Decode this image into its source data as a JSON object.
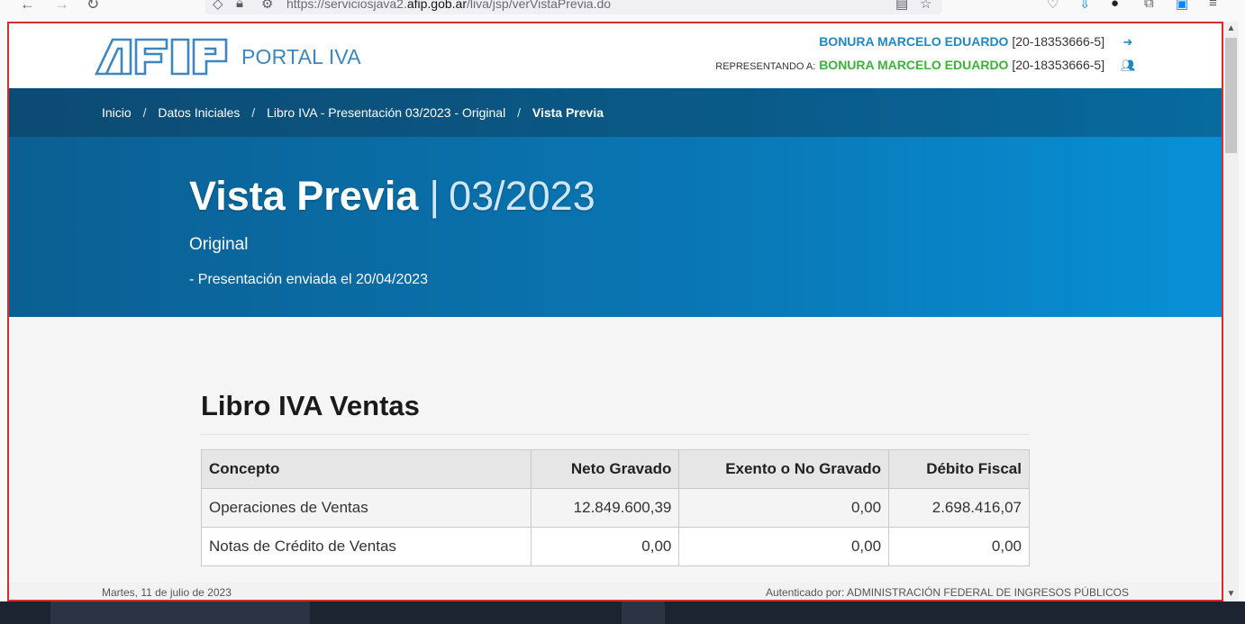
{
  "browser": {
    "url_prefix": "https://serviciosjava2.",
    "url_domain": "afip.gob.ar",
    "url_path": "/liva/jsp/verVistaPrevia.do"
  },
  "header": {
    "app_name": "PORTAL IVA",
    "user_name": "BONURA MARCELO EDUARDO",
    "user_cuit": "[20-18353666-5]",
    "representing_label": "REPRESENTANDO A:",
    "represented_name": "BONURA MARCELO EDUARDO",
    "represented_cuit": "[20-18353666-5]"
  },
  "breadcrumb": {
    "items": [
      "Inicio",
      "Datos Iniciales",
      "Libro IVA - Presentación 03/2023 - Original",
      "Vista Previa"
    ],
    "separator": "/"
  },
  "hero": {
    "title": "Vista Previa",
    "separator": "|",
    "period": "03/2023",
    "subtitle": "Original",
    "note": "- Presentación enviada el 20/04/2023"
  },
  "section": {
    "title": "Libro IVA Ventas",
    "table": {
      "headers": [
        "Concepto",
        "Neto Gravado",
        "Exento o No Gravado",
        "Débito Fiscal"
      ],
      "rows": [
        [
          "Operaciones de Ventas",
          "12.849.600,39",
          "0,00",
          "2.698.416,07"
        ],
        [
          "Notas de Crédito de Ventas",
          "0,00",
          "0,00",
          "0,00"
        ]
      ]
    }
  },
  "footer": {
    "date": "Martes, 11 de julio de 2023",
    "authenticated": "Autenticado por: ADMINISTRACIÓN FEDERAL DE INGRESOS PÚBLICOS"
  },
  "colors": {
    "brand_blue": "#3d86bf",
    "user_name_blue": "#1e88c6",
    "represented_green": "#3bb33b",
    "frame_red": "#d32f2f"
  },
  "icons": [
    "back-arrow-icon",
    "forward-arrow-icon",
    "reload-icon",
    "shield-icon",
    "lock-icon",
    "permissions-icon",
    "reader-view-icon",
    "bookmark-star-icon",
    "pocket-icon",
    "download-icon",
    "account-icon",
    "extensions-icon",
    "menu-icon",
    "logout-icon",
    "users-icon"
  ]
}
